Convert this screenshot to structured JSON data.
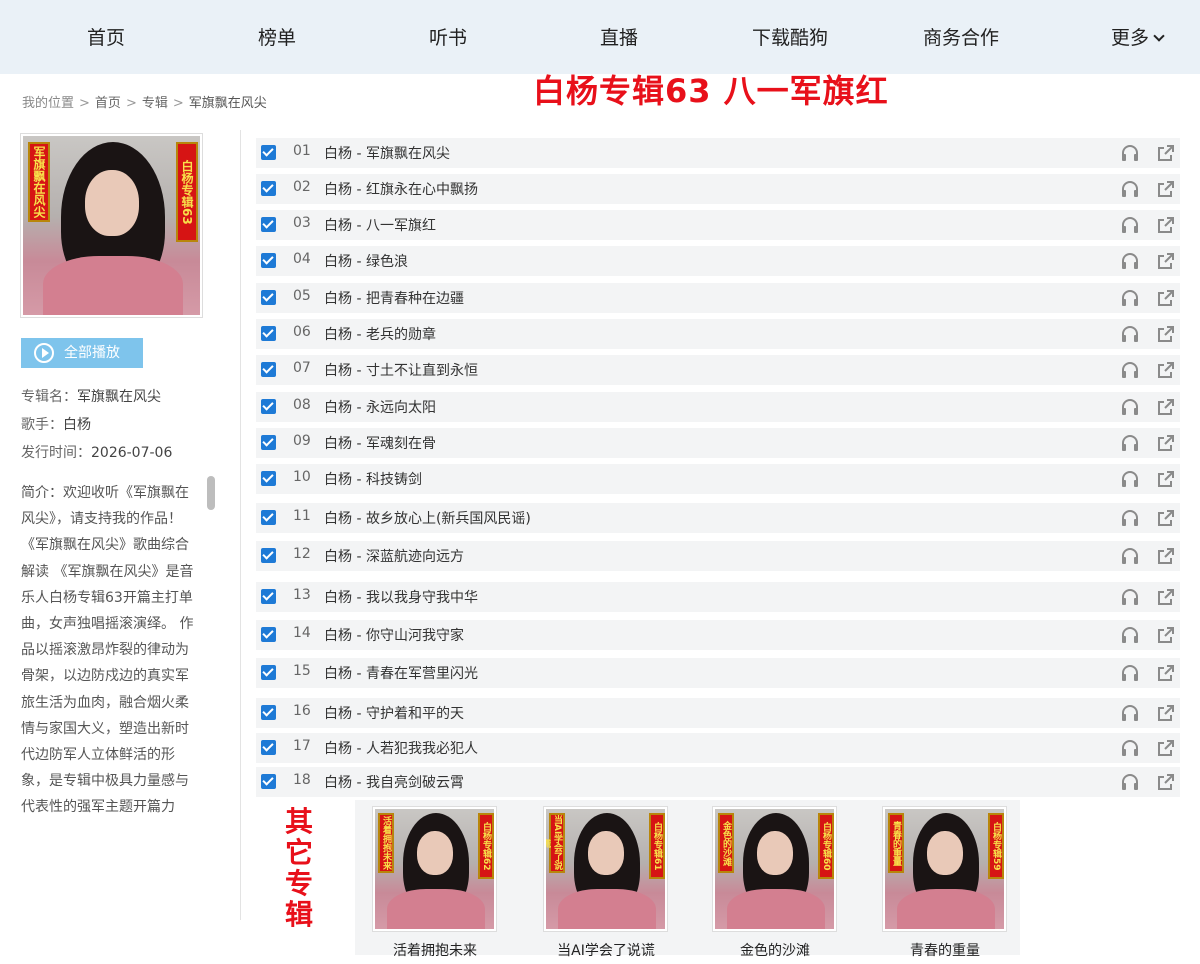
{
  "nav": {
    "items": [
      "首页",
      "榜单",
      "听书",
      "直播",
      "下载酷狗",
      "商务合作"
    ],
    "more_label": "更多"
  },
  "breadcrumb": {
    "prefix": "我的位置",
    "items": [
      "首页",
      "专辑",
      "军旗飘在风尖"
    ]
  },
  "overlay_title": "白杨专辑63  八一军旗红",
  "album": {
    "cover_left_text": "军旗飘在风尖",
    "cover_right_text": "白杨专辑63",
    "play_all_label": "全部播放",
    "name_label": "专辑名：",
    "name_value": "军旗飘在风尖",
    "singer_label": "歌手：",
    "singer_value": "白杨",
    "date_label": "发行时间：",
    "date_value": "2026-07-06",
    "intro": "简介：欢迎收听《军旗飘在风尖》，请支持我的作品！《军旗飘在风尖》歌曲综合解读 《军旗飘在风尖》是音乐人白杨专辑63开篇主打单曲，女声独唱摇滚演绎。 作品以摇滚激昂炸裂的律动为骨架，以边防戍边的真实军旅生活为血肉，融合烟火柔情与家国大义，塑造出新时代边防军人立体鲜活的形象，是专辑中极具力量感与代表性的强军主题开篇力"
  },
  "tracks": [
    {
      "num": "01",
      "title": "白杨 - 军旗飘在风尖"
    },
    {
      "num": "02",
      "title": "白杨 - 红旗永在心中飘扬"
    },
    {
      "num": "03",
      "title": "白杨 - 八一军旗红"
    },
    {
      "num": "04",
      "title": "白杨 - 绿色浪"
    },
    {
      "num": "05",
      "title": "白杨 - 把青春种在边疆"
    },
    {
      "num": "06",
      "title": "白杨 - 老兵的勋章"
    },
    {
      "num": "07",
      "title": "白杨 - 寸土不让直到永恒"
    },
    {
      "num": "08",
      "title": "白杨 - 永远向太阳"
    },
    {
      "num": "09",
      "title": "白杨 - 军魂刻在骨"
    },
    {
      "num": "10",
      "title": "白杨 - 科技铸剑"
    },
    {
      "num": "11",
      "title": "白杨 - 故乡放心上(新兵国风民谣)"
    },
    {
      "num": "12",
      "title": "白杨 - 深蓝航迹向远方"
    },
    {
      "num": "13",
      "title": "白杨 - 我以我身守我中华"
    },
    {
      "num": "14",
      "title": "白杨 - 你守山河我守家"
    },
    {
      "num": "15",
      "title": "白杨 - 青春在军营里闪光"
    },
    {
      "num": "16",
      "title": "白杨 - 守护着和平的天"
    },
    {
      "num": "17",
      "title": "白杨 - 人若犯我我必犯人"
    },
    {
      "num": "18",
      "title": "白杨 - 我自亮剑破云霄"
    }
  ],
  "other_albums": {
    "label": "其它专辑",
    "items": [
      {
        "name": "活着拥抱未来",
        "left_text": "活着拥抱未来",
        "right_text": "白杨专辑62"
      },
      {
        "name": "当AI学会了说谎",
        "left_text": "当AI学会了说谎",
        "right_text": "白杨专辑61"
      },
      {
        "name": "金色的沙滩",
        "left_text": "金色的沙滩",
        "right_text": "白杨专辑60"
      },
      {
        "name": "青春的重量",
        "left_text": "青春的重量",
        "right_text": "白杨专辑59"
      }
    ]
  },
  "colors": {
    "nav_bg": "#eaf1f7",
    "accent_red": "#e8101a",
    "checkbox_blue": "#1e7ad6",
    "play_all_bg": "#7ec4ec",
    "row_bg": "#f3f4f5"
  },
  "icons": {
    "listen": "headphones-icon",
    "share": "share-icon",
    "play_all": "play-circle-icon",
    "more": "chevron-down-icon"
  }
}
